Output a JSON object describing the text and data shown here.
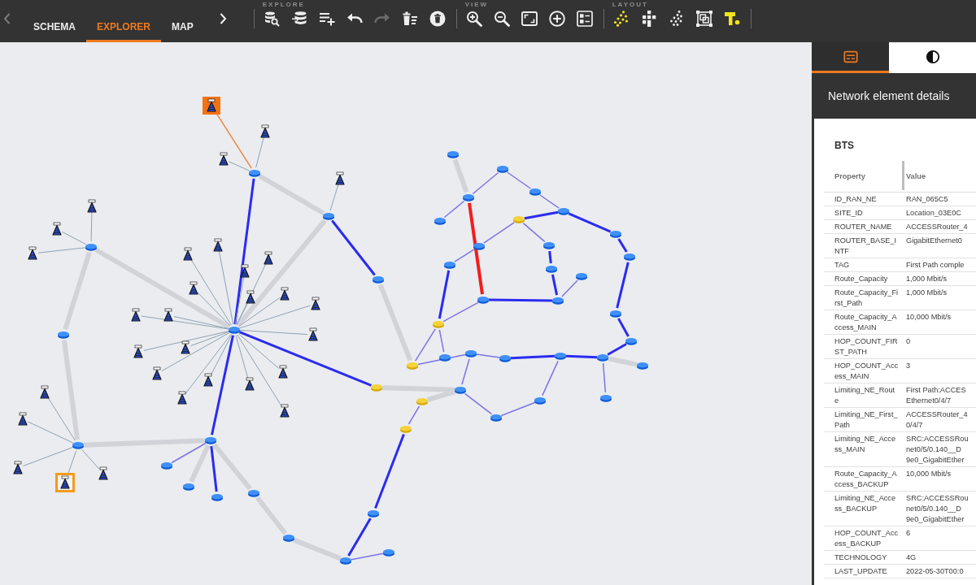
{
  "toolbar": {
    "tab_scroll_left": {
      "disabled": true
    },
    "tabs": [
      {
        "label": "SCHEMA",
        "selected": false
      },
      {
        "label": "EXPLORER",
        "selected": true
      },
      {
        "label": "MAP",
        "selected": false
      }
    ],
    "tab_scroll_right": {
      "disabled": false
    },
    "groups": [
      {
        "label": "EXPLORE",
        "tools": [
          {
            "kind": "search-database",
            "disabled": false
          },
          {
            "kind": "database-import",
            "disabled": false
          },
          {
            "kind": "list-add",
            "disabled": false
          },
          {
            "kind": "undo",
            "disabled": false
          },
          {
            "kind": "redo",
            "disabled": true
          },
          {
            "kind": "delete-list",
            "disabled": false
          },
          {
            "kind": "delete-circle",
            "disabled": false
          }
        ]
      },
      {
        "label": "VIEW",
        "tools": [
          {
            "kind": "zoom-in",
            "disabled": false
          },
          {
            "kind": "zoom-out",
            "disabled": false
          },
          {
            "kind": "fit-screen",
            "disabled": false
          },
          {
            "kind": "add-circle",
            "disabled": false
          },
          {
            "kind": "list-layout",
            "disabled": false
          }
        ]
      },
      {
        "label": "LAYOUT",
        "tools": [
          {
            "kind": "layout-force",
            "disabled": false
          },
          {
            "kind": "layout-grid",
            "disabled": false
          },
          {
            "kind": "layout-scatter",
            "disabled": false
          },
          {
            "kind": "layout-frame",
            "disabled": false
          },
          {
            "kind": "layout-hierarchy",
            "disabled": false
          }
        ]
      }
    ]
  },
  "graph": {
    "nodes": [
      {
        "kind": "bts",
        "selected": true,
        "hovered": false
      },
      {
        "kind": "bts",
        "selected": false,
        "hovered": false
      },
      {
        "kind": "bts",
        "selected": false,
        "hovered": false
      },
      {
        "kind": "bts",
        "selected": false,
        "hovered": false
      },
      {
        "kind": "bts",
        "selected": false,
        "hovered": false
      },
      {
        "kind": "bts",
        "selected": false,
        "hovered": false
      },
      {
        "kind": "bts",
        "selected": false,
        "hovered": false
      },
      {
        "kind": "bts",
        "selected": false,
        "hovered": false
      },
      {
        "kind": "bts",
        "selected": false,
        "hovered": false
      },
      {
        "kind": "bts",
        "selected": false,
        "hovered": false
      },
      {
        "kind": "bts",
        "selected": false,
        "hovered": false
      },
      {
        "kind": "bts",
        "selected": false,
        "hovered": false
      },
      {
        "kind": "bts",
        "selected": false,
        "hovered": false
      },
      {
        "kind": "bts",
        "selected": false,
        "hovered": false
      },
      {
        "kind": "bts",
        "selected": false,
        "hovered": false
      },
      {
        "kind": "bts",
        "selected": false,
        "hovered": false
      },
      {
        "kind": "bts",
        "selected": false,
        "hovered": false
      },
      {
        "kind": "bts",
        "selected": false,
        "hovered": false
      },
      {
        "kind": "bts",
        "selected": false,
        "hovered": false
      },
      {
        "kind": "bts",
        "selected": false,
        "hovered": false
      },
      {
        "kind": "bts",
        "selected": false,
        "hovered": false
      },
      {
        "kind": "bts",
        "selected": false,
        "hovered": false
      },
      {
        "kind": "bts",
        "selected": false,
        "hovered": false
      },
      {
        "kind": "bts",
        "selected": false,
        "hovered": false
      },
      {
        "kind": "bts",
        "selected": false,
        "hovered": false
      },
      {
        "kind": "bts",
        "selected": false,
        "hovered": false
      },
      {
        "kind": "bts",
        "selected": false,
        "hovered": false
      },
      {
        "kind": "bts",
        "selected": false,
        "hovered": false
      },
      {
        "kind": "bts",
        "selected": false,
        "hovered": false
      },
      {
        "kind": "bts",
        "selected": false,
        "hovered": false
      },
      {
        "kind": "bts",
        "selected": false,
        "hovered": true
      },
      {
        "kind": "router",
        "selected": false,
        "hovered": false
      },
      {
        "kind": "router",
        "selected": false,
        "hovered": false
      },
      {
        "kind": "router",
        "selected": false,
        "hovered": false
      },
      {
        "kind": "router",
        "selected": false,
        "hovered": false
      },
      {
        "kind": "router",
        "selected": false,
        "hovered": false
      },
      {
        "kind": "router",
        "selected": false,
        "hovered": false
      },
      {
        "kind": "router",
        "selected": false,
        "hovered": false
      },
      {
        "kind": "router",
        "selected": false,
        "hovered": false
      },
      {
        "kind": "router",
        "selected": false,
        "hovered": false
      },
      {
        "kind": "router",
        "selected": false,
        "hovered": false
      },
      {
        "kind": "router",
        "selected": false,
        "hovered": false
      },
      {
        "kind": "router",
        "selected": false,
        "hovered": false
      },
      {
        "kind": "router",
        "selected": false,
        "hovered": false
      },
      {
        "kind": "router",
        "selected": false,
        "hovered": false
      },
      {
        "kind": "router",
        "selected": false,
        "hovered": false
      },
      {
        "kind": "router",
        "selected": false,
        "hovered": false
      },
      {
        "kind": "gateway",
        "selected": false,
        "hovered": false
      },
      {
        "kind": "gateway",
        "selected": false,
        "hovered": false
      },
      {
        "kind": "gateway",
        "selected": false,
        "hovered": false
      },
      {
        "kind": "gateway",
        "selected": false,
        "hovered": false
      },
      {
        "kind": "gateway",
        "selected": false,
        "hovered": false
      },
      {
        "kind": "gateway",
        "selected": false,
        "hovered": false
      },
      {
        "kind": "router",
        "selected": false,
        "hovered": false
      },
      {
        "kind": "router",
        "selected": false,
        "hovered": false
      },
      {
        "kind": "router",
        "selected": false,
        "hovered": false
      },
      {
        "kind": "router",
        "selected": false,
        "hovered": false
      },
      {
        "kind": "router",
        "selected": false,
        "hovered": false
      },
      {
        "kind": "router",
        "selected": false,
        "hovered": false
      },
      {
        "kind": "router",
        "selected": false,
        "hovered": false
      },
      {
        "kind": "router",
        "selected": false,
        "hovered": false
      },
      {
        "kind": "router",
        "selected": false,
        "hovered": false
      },
      {
        "kind": "router",
        "selected": false,
        "hovered": false
      },
      {
        "kind": "router",
        "selected": false,
        "hovered": false
      },
      {
        "kind": "router",
        "selected": false,
        "hovered": false
      },
      {
        "kind": "router",
        "selected": false,
        "hovered": false
      },
      {
        "kind": "router",
        "selected": false,
        "hovered": false
      },
      {
        "kind": "router",
        "selected": false,
        "hovered": false
      },
      {
        "kind": "router",
        "selected": false,
        "hovered": false
      },
      {
        "kind": "router",
        "selected": false,
        "hovered": false
      },
      {
        "kind": "router",
        "selected": false,
        "hovered": false
      },
      {
        "kind": "router",
        "selected": false,
        "hovered": false
      },
      {
        "kind": "router",
        "selected": false,
        "hovered": false
      },
      {
        "kind": "router",
        "selected": false,
        "hovered": false
      },
      {
        "kind": "router",
        "selected": false,
        "hovered": false
      },
      {
        "kind": "router",
        "selected": false,
        "hovered": false
      },
      {
        "kind": "router",
        "selected": false,
        "hovered": false
      },
      {
        "kind": "router",
        "selected": false,
        "hovered": false
      },
      {
        "kind": "router",
        "selected": false,
        "hovered": false
      },
      {
        "kind": "router",
        "selected": false,
        "hovered": false
      }
    ],
    "links": [
      {
        "kind": "radio-active"
      },
      {
        "kind": "radio"
      },
      {
        "kind": "radio"
      },
      {
        "kind": "aggregate"
      },
      {
        "kind": "core"
      },
      {
        "kind": "radio"
      },
      {
        "kind": "core"
      },
      {
        "kind": "aggregate"
      },
      {
        "kind": "aggregate"
      },
      {
        "kind": "radio"
      },
      {
        "kind": "radio"
      },
      {
        "kind": "radio"
      },
      {
        "kind": "aggregate"
      },
      {
        "kind": "aggregate"
      },
      {
        "kind": "aggregate"
      },
      {
        "kind": "radio"
      },
      {
        "kind": "radio"
      },
      {
        "kind": "radio"
      },
      {
        "kind": "radio"
      },
      {
        "kind": "radio"
      },
      {
        "kind": "radio"
      },
      {
        "kind": "radio"
      },
      {
        "kind": "radio"
      },
      {
        "kind": "radio"
      },
      {
        "kind": "radio"
      },
      {
        "kind": "radio"
      },
      {
        "kind": "radio"
      },
      {
        "kind": "radio"
      },
      {
        "kind": "radio"
      },
      {
        "kind": "radio"
      },
      {
        "kind": "radio"
      },
      {
        "kind": "radio"
      },
      {
        "kind": "radio"
      },
      {
        "kind": "radio"
      },
      {
        "kind": "radio"
      },
      {
        "kind": "radio"
      },
      {
        "kind": "radio"
      },
      {
        "kind": "radio"
      },
      {
        "kind": "radio"
      },
      {
        "kind": "aggregate"
      },
      {
        "kind": "core"
      },
      {
        "kind": "core"
      },
      {
        "kind": "metro"
      },
      {
        "kind": "aggregate"
      },
      {
        "kind": "core"
      },
      {
        "kind": "aggregate"
      },
      {
        "kind": "aggregate"
      },
      {
        "kind": "aggregate"
      },
      {
        "kind": "core"
      },
      {
        "kind": "core"
      },
      {
        "kind": "metro"
      },
      {
        "kind": "metro"
      },
      {
        "kind": "aggregate"
      },
      {
        "kind": "aggregate"
      },
      {
        "kind": "metro"
      },
      {
        "kind": "metro"
      },
      {
        "kind": "core"
      },
      {
        "kind": "metro"
      },
      {
        "kind": "metro"
      },
      {
        "kind": "metro"
      },
      {
        "kind": "down"
      },
      {
        "kind": "aggregate"
      },
      {
        "kind": "metro"
      },
      {
        "kind": "metro"
      },
      {
        "kind": "metro"
      },
      {
        "kind": "metro"
      },
      {
        "kind": "metro"
      },
      {
        "kind": "core"
      },
      {
        "kind": "core"
      },
      {
        "kind": "core"
      },
      {
        "kind": "metro"
      },
      {
        "kind": "core"
      },
      {
        "kind": "core"
      },
      {
        "kind": "core"
      },
      {
        "kind": "metro"
      },
      {
        "kind": "core"
      },
      {
        "kind": "core"
      },
      {
        "kind": "core"
      },
      {
        "kind": "core"
      },
      {
        "kind": "core"
      },
      {
        "kind": "metro"
      },
      {
        "kind": "metro"
      },
      {
        "kind": "metro"
      },
      {
        "kind": "metro"
      },
      {
        "kind": "metro"
      },
      {
        "kind": "metro"
      },
      {
        "kind": "aggregate"
      }
    ]
  },
  "panel": {
    "tabs": [
      {
        "kind": "details",
        "selected": true
      },
      {
        "kind": "style",
        "selected": false
      }
    ],
    "title": "Network element details",
    "section": "BTS",
    "columns": [
      "Property",
      "Value"
    ],
    "rows": [
      {
        "property": "ID_RAN_NE",
        "value": "RAN_065C5"
      },
      {
        "property": "SITE_ID",
        "value": "Location_03E0C"
      },
      {
        "property": "ROUTER_NAME",
        "value": "ACCESSRouter_4"
      },
      {
        "property": "ROUTER_BASE_INTF",
        "value": "GigabitEthernet0"
      },
      {
        "property": "TAG",
        "value": "First Path comple"
      },
      {
        "property": "Route_Capacity",
        "value": "1,000 Mbit/s"
      },
      {
        "property": "Route_Capacity_First_Path",
        "value": "1,000 Mbit/s"
      },
      {
        "property": "Route_Capacity_Access_MAIN",
        "value": "10,000 Mbit/s"
      },
      {
        "property": "HOP_COUNT_FIRST_PATH",
        "value": "0"
      },
      {
        "property": "HOP_COUNT_Access_MAIN",
        "value": "3"
      },
      {
        "property": "Limiting_NE_Route",
        "value": "First Path:ACCES\nEthernet0/4/7"
      },
      {
        "property": "Limiting_NE_First_Path",
        "value": "ACCESSRouter_4\n0/4/7"
      },
      {
        "property": "Limiting_NE_Access_MAIN",
        "value": "SRC:ACCESSRou\nnet0/5/0.140__D\n9e0_GigabitEther"
      },
      {
        "property": "Route_Capacity_Access_BACKUP",
        "value": "10,000 Mbit/s"
      },
      {
        "property": "Limiting_NE_Access_BACKUP",
        "value": "SRC:ACCESSRou\nnet0/5/0.140__D\n9e0_GigabitEther"
      },
      {
        "property": "HOP_COUNT_Access_BACKUP",
        "value": "6"
      },
      {
        "property": "TECHNOLOGY",
        "value": "4G"
      },
      {
        "property": "LAST_UPDATE",
        "value": "2022-05-30T00:0"
      }
    ]
  }
}
